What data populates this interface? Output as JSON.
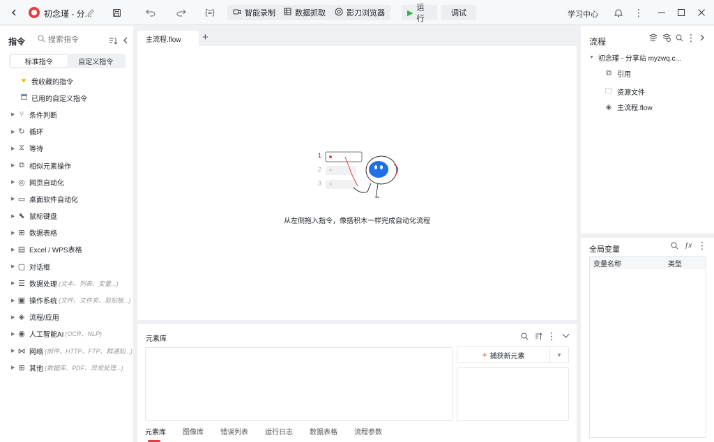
{
  "titlebar": {
    "app_title": "初念瑾 - 分...",
    "buttons": {
      "smart_record": "智能录制",
      "data_capture": "数据抓取",
      "browser": "影刀浏览器",
      "run": "运行",
      "debug": "调试"
    },
    "study_center": "学习中心",
    "var_icon_text": "{≡}"
  },
  "left": {
    "header": "指令",
    "search_placeholder": "搜索指令",
    "tabs": [
      "标准指令",
      "自定义指令"
    ],
    "top_items": [
      {
        "label": "我收藏的指令",
        "icon": "heart-icon"
      },
      {
        "label": "已用的自定义指令",
        "icon": "calendar-icon"
      }
    ],
    "items": [
      {
        "label": "条件判断",
        "hint": "",
        "icon": "branch-icon"
      },
      {
        "label": "循环",
        "hint": "",
        "icon": "loop-icon"
      },
      {
        "label": "等待",
        "hint": "",
        "icon": "hourglass-icon"
      },
      {
        "label": "相似元素操作",
        "hint": "",
        "icon": "similar-icon"
      },
      {
        "label": "网页自动化",
        "hint": "",
        "icon": "globe-icon"
      },
      {
        "label": "桌面软件自动化",
        "hint": "",
        "icon": "monitor-icon"
      },
      {
        "label": "鼠标键盘",
        "hint": "",
        "icon": "cursor-icon"
      },
      {
        "label": "数据表格",
        "hint": "",
        "icon": "table-icon"
      },
      {
        "label": "Excel / WPS表格",
        "hint": "",
        "icon": "excel-icon"
      },
      {
        "label": "对话框",
        "hint": "",
        "icon": "dialog-icon"
      },
      {
        "label": "数据处理",
        "hint": "(文本、列表、变量...)",
        "icon": "data-icon"
      },
      {
        "label": "操作系统",
        "hint": "(文件、文件夹、剪贴板...)",
        "icon": "os-icon"
      },
      {
        "label": "流程/应用",
        "hint": "",
        "icon": "layers-icon"
      },
      {
        "label": "人工智能AI",
        "hint": "(OCR、NLP)",
        "icon": "ai-icon"
      },
      {
        "label": "网络",
        "hint": "(邮件、HTTP、FTP、群通知...)",
        "icon": "network-icon"
      },
      {
        "label": "其他",
        "hint": "(数据库、PDF、异常处理...)",
        "icon": "grid-icon"
      }
    ]
  },
  "center": {
    "tab": "主流程.flow",
    "empty_message": "从左侧拖入指令，像搭积木一样完成自动化流程",
    "illus_numbers": [
      "1",
      "2",
      "3"
    ]
  },
  "element_panel": {
    "title": "元素库",
    "capture_button": "捕获新元素",
    "tabs": [
      "元素库",
      "图像库",
      "错误列表",
      "运行日志",
      "数据表格",
      "流程参数"
    ]
  },
  "right": {
    "title": "流程",
    "tree_root": "初念瑾 - 分享站  myzwq.c...",
    "tree_items": [
      {
        "label": "引用",
        "icon": "copy-icon"
      },
      {
        "label": "资源文件",
        "icon": "folder-icon"
      },
      {
        "label": "主流程.flow",
        "icon": "layers-icon"
      }
    ],
    "globals_title": "全局变量",
    "fx_label": "ƒx",
    "columns": [
      "变量名称",
      "类型"
    ]
  }
}
